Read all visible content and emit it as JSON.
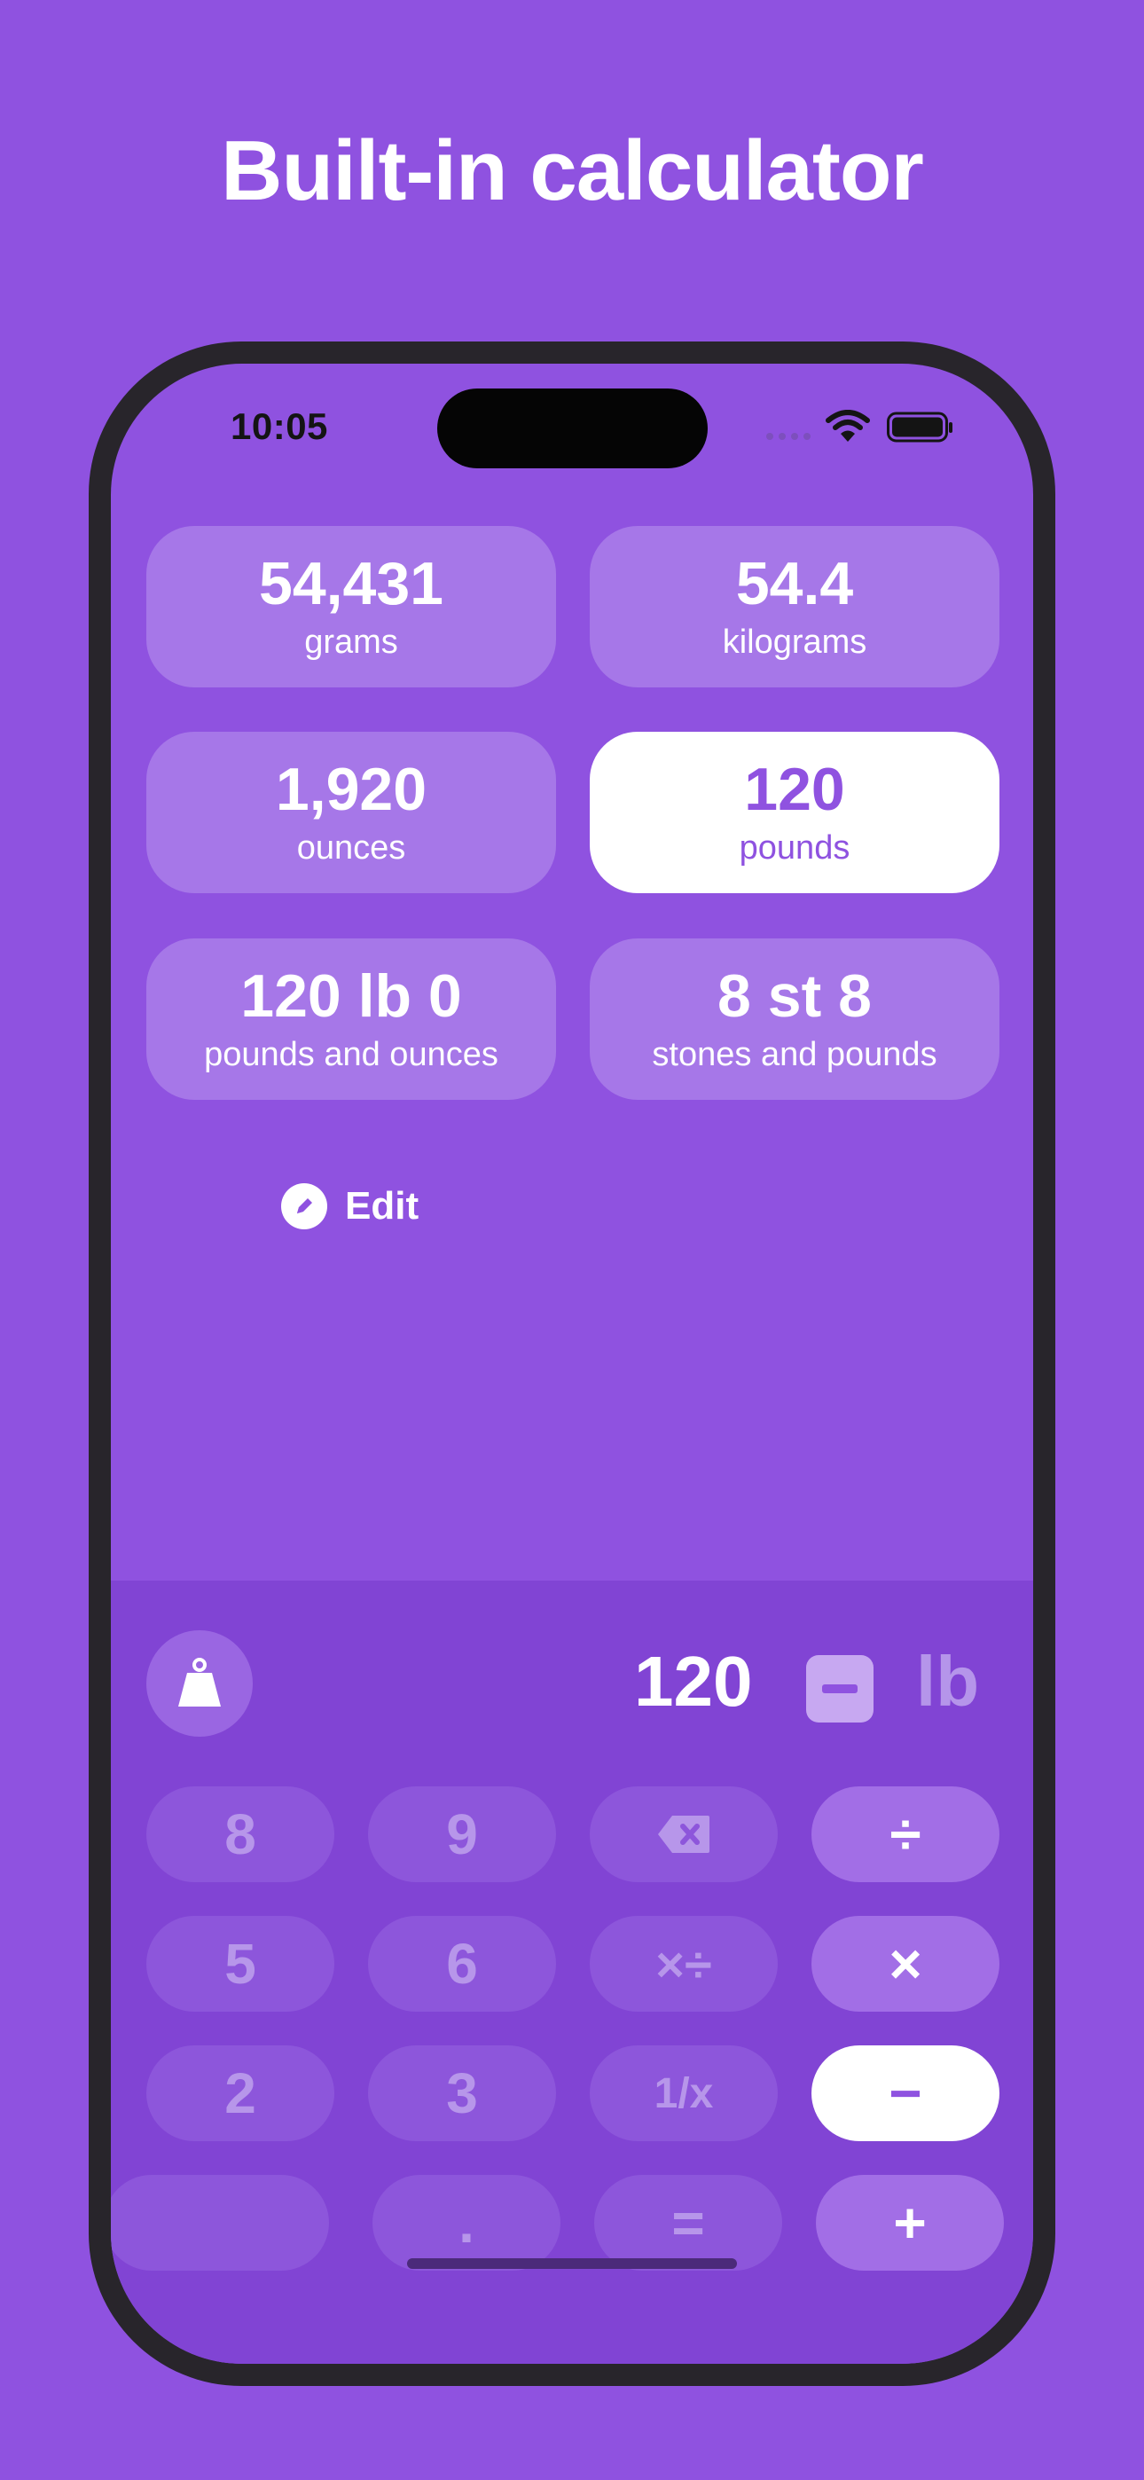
{
  "headline": "Built-in calculator",
  "status_bar": {
    "time": "10:05"
  },
  "conversions": [
    {
      "value": "54,431",
      "unit": "grams"
    },
    {
      "value": "54.4",
      "unit": "kilograms"
    },
    {
      "value": "1,920",
      "unit": "ounces"
    },
    {
      "value": "120",
      "unit": "pounds",
      "selected": true
    },
    {
      "value": "120 lb 0",
      "unit": "pounds and ounces"
    },
    {
      "value": "8 st 8",
      "unit": "stones and pounds"
    }
  ],
  "edit_label": "Edit",
  "input": {
    "value": "120",
    "unit": "lb"
  },
  "keys": {
    "row1": [
      "8",
      "9",
      "⌫",
      "÷"
    ],
    "row2": [
      "5",
      "6",
      "×÷",
      "×"
    ],
    "row3": [
      "2",
      "3",
      "1/x",
      "−"
    ],
    "row4": [
      "",
      ".",
      "=",
      "+"
    ]
  },
  "colors": {
    "background": "#8F52E0",
    "tile": "#A677E8",
    "selected_tile": "#ffffff",
    "keyboard": "#8144D4",
    "key": "#8D56DB",
    "operator_key": "#A26EE6"
  },
  "icons": {
    "weight": "weight-icon",
    "edit": "pencil-icon",
    "backspace": "backspace-icon",
    "minus_toggle": "minus-square-icon"
  }
}
